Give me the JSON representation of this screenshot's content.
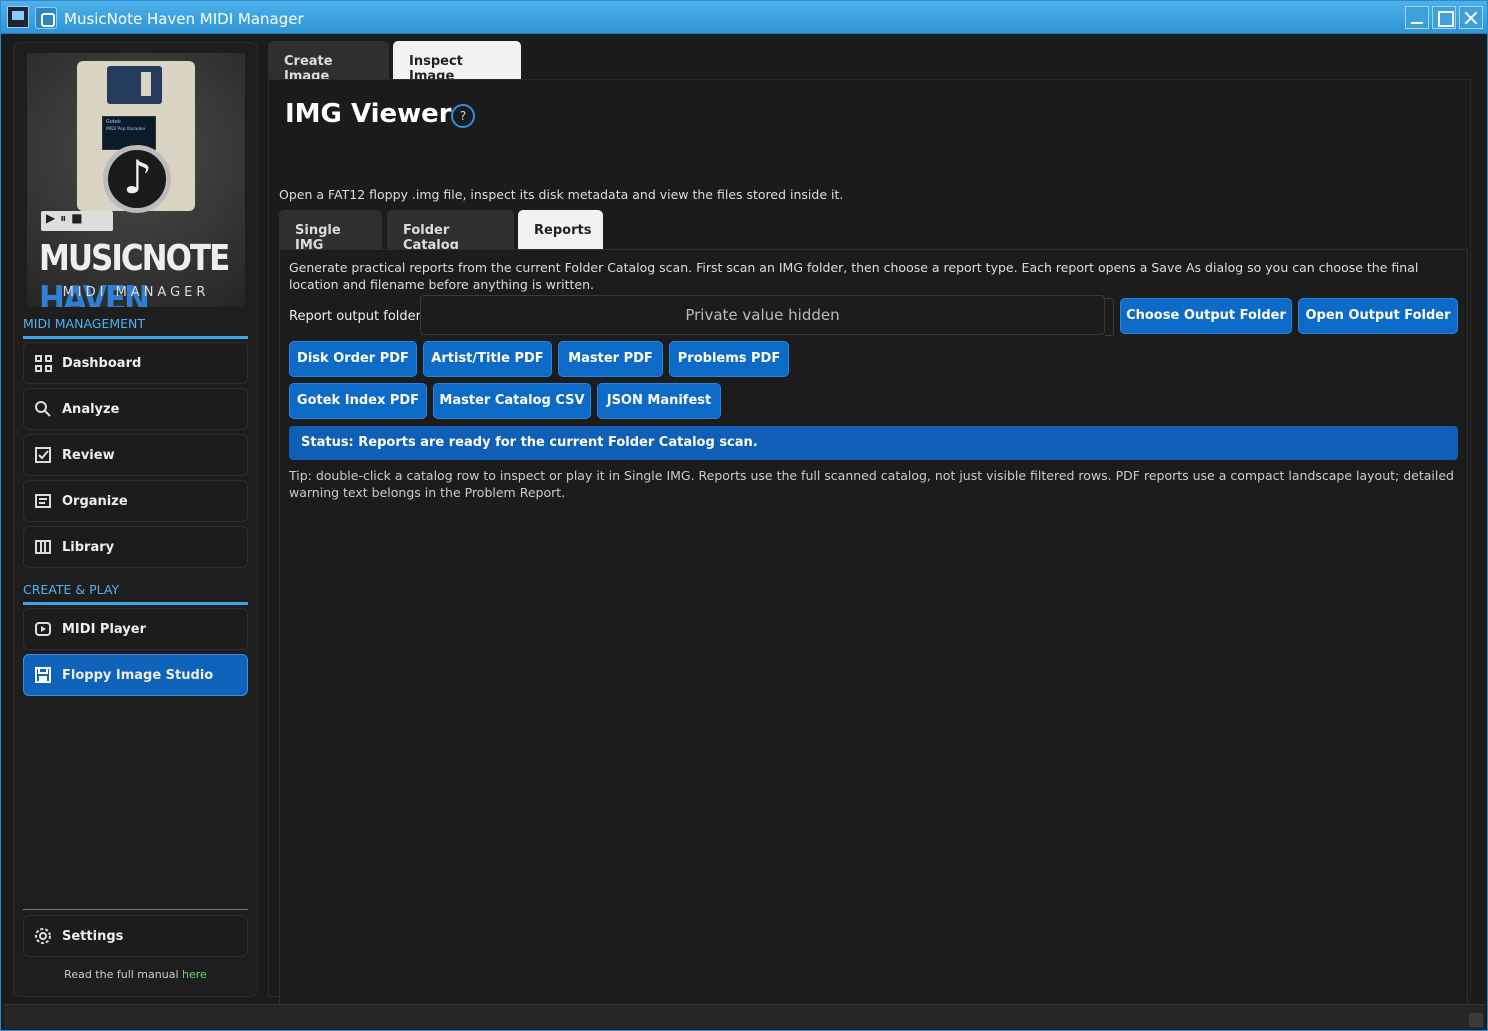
{
  "window": {
    "title": "MusicNote Haven MIDI Manager"
  },
  "logo": {
    "brand_main": "MUSICNOTE",
    "brand_accent": "HAVEN",
    "subtitle": "MIDI MANAGER",
    "screen_text": "Gotek",
    "screen_sub": "MIDI Pop Karaoke",
    "controls": "▶⏸■"
  },
  "sidebar": {
    "section1": "MIDI MANAGEMENT",
    "items1": [
      {
        "label": "Dashboard",
        "icon": "grid-icon"
      },
      {
        "label": "Analyze",
        "icon": "search-icon"
      },
      {
        "label": "Review",
        "icon": "checkbox-icon"
      },
      {
        "label": "Organize",
        "icon": "list-icon"
      },
      {
        "label": "Library",
        "icon": "columns-icon"
      }
    ],
    "section2": "CREATE & PLAY",
    "items2": [
      {
        "label": "MIDI Player",
        "icon": "play-icon"
      },
      {
        "label": "Floppy Image Studio",
        "icon": "floppy-icon"
      }
    ],
    "settings": "Settings",
    "manual_text": "Read the full manual",
    "manual_link": "here"
  },
  "tabs": {
    "create": "Create Image",
    "inspect": "Inspect Image"
  },
  "viewer": {
    "title": "IMG Viewer",
    "help": "?",
    "subtitle": "Open a FAT12 floppy .img file, inspect its disk metadata and view the files stored inside it.",
    "subtabs": {
      "single": "Single IMG",
      "folder": "Folder Catalog",
      "reports": "Reports"
    }
  },
  "reports": {
    "description": "Generate practical reports from the current Folder Catalog scan. First scan an IMG folder, then choose a report type. Each report opens a Save As dialog so you can choose the final location and filename before anything is written.",
    "output_label": "Report output folder",
    "output_value": "Private value hidden",
    "choose_btn": "Choose Output Folder",
    "open_btn": "Open Output Folder",
    "row1": [
      "Disk Order PDF",
      "Artist/Title PDF",
      "Master PDF",
      "Problems PDF"
    ],
    "row2": [
      "Gotek Index PDF",
      "Master Catalog CSV",
      "JSON Manifest"
    ],
    "status": "Status: Reports are ready for the current Folder Catalog scan.",
    "tip": "Tip: double-click a catalog row to inspect or play it in Single IMG. Reports use the full scanned catalog, not just visible filtered rows. PDF reports use a compact landscape layout; detailed warning text belongs in the Problem Report."
  },
  "colors": {
    "accent": "#0e6ac7",
    "section": "#4fb3f0",
    "active_nav": "#0f63b8",
    "link": "#6bd46b"
  }
}
